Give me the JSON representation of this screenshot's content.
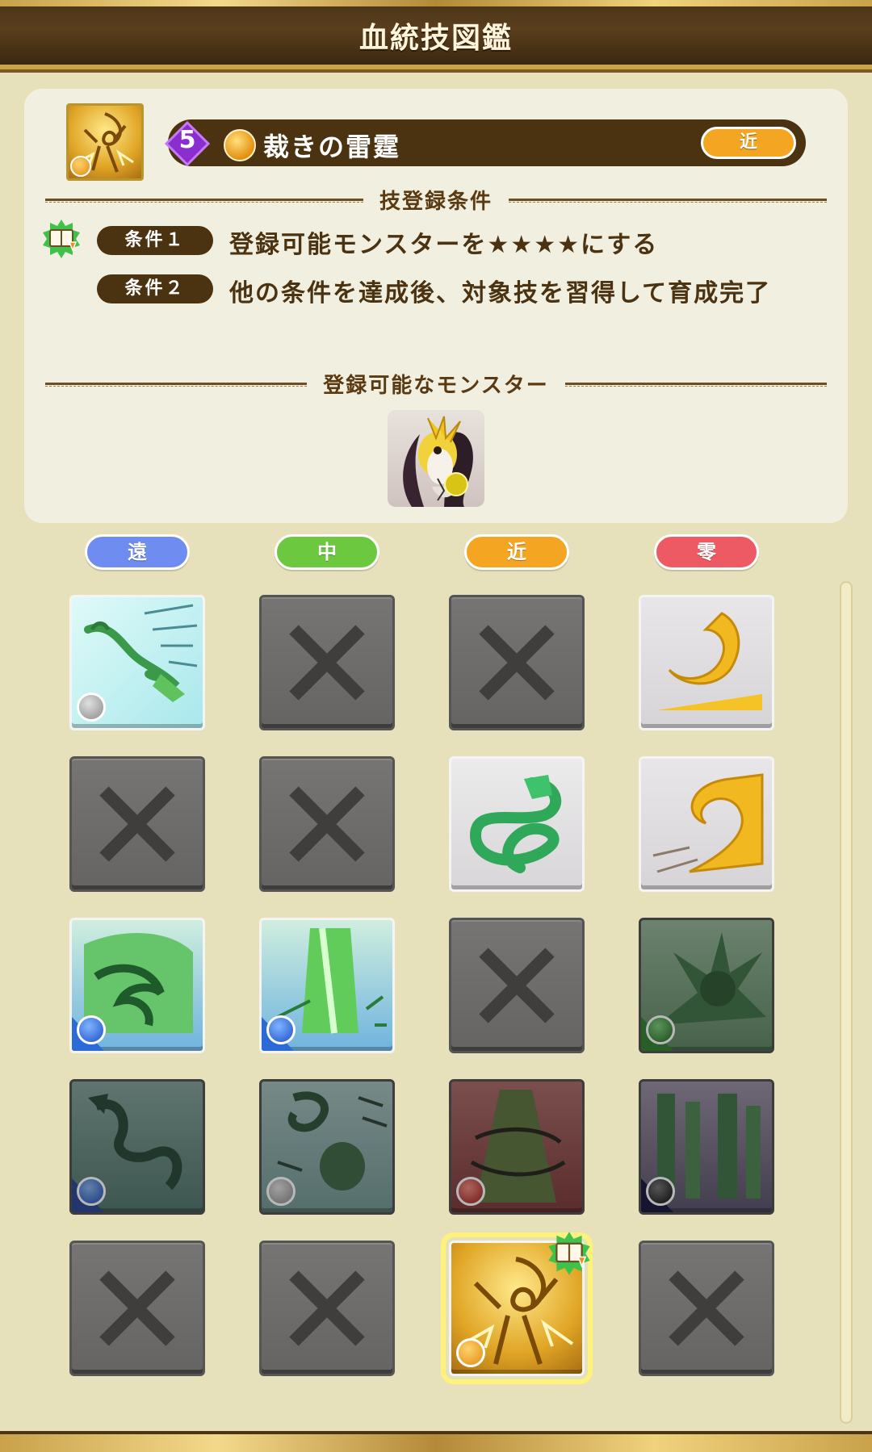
{
  "header": {
    "title": "血統技図鑑"
  },
  "skill": {
    "rank": "5",
    "name": "裁きの雷霆",
    "range_label": "近"
  },
  "conditions": {
    "heading": "技登録条件",
    "items": [
      {
        "badge": "条件１",
        "text": "登録可能モンスターを★★★★にする"
      },
      {
        "badge": "条件２",
        "text": "他の条件を達成後、対象技を習得して育成完了"
      }
    ]
  },
  "monsters": {
    "heading": "登録可能なモンスター"
  },
  "tabs": [
    {
      "label": "遠",
      "color": "#6f8df0"
    },
    {
      "label": "中",
      "color": "#6cc83f"
    },
    {
      "label": "近",
      "color": "#f4a623"
    },
    {
      "label": "零",
      "color": "#ee5a63"
    }
  ],
  "grid": [
    [
      "dragon-rush-icon",
      "locked",
      "locked",
      "golden-arc-icon"
    ],
    [
      "locked",
      "locked",
      "serpent-coil-icon",
      "golden-swirl-icon"
    ],
    [
      "dragon-wave-icon",
      "green-pillar-icon",
      "locked",
      "spiked-orb-icon"
    ],
    [
      "shadow-dragon-icon",
      "fist-swirl-icon",
      "thorn-pillar-icon",
      "bamboo-forest-icon"
    ],
    [
      "locked",
      "locked",
      "judgement-thunder-icon",
      "locked"
    ]
  ],
  "colors": {
    "header": "#4a3418",
    "accent_brown": "#4b3211",
    "panel": "#f1efdf",
    "background": "#e6e1bb",
    "selected_outline": "#fff27a"
  }
}
